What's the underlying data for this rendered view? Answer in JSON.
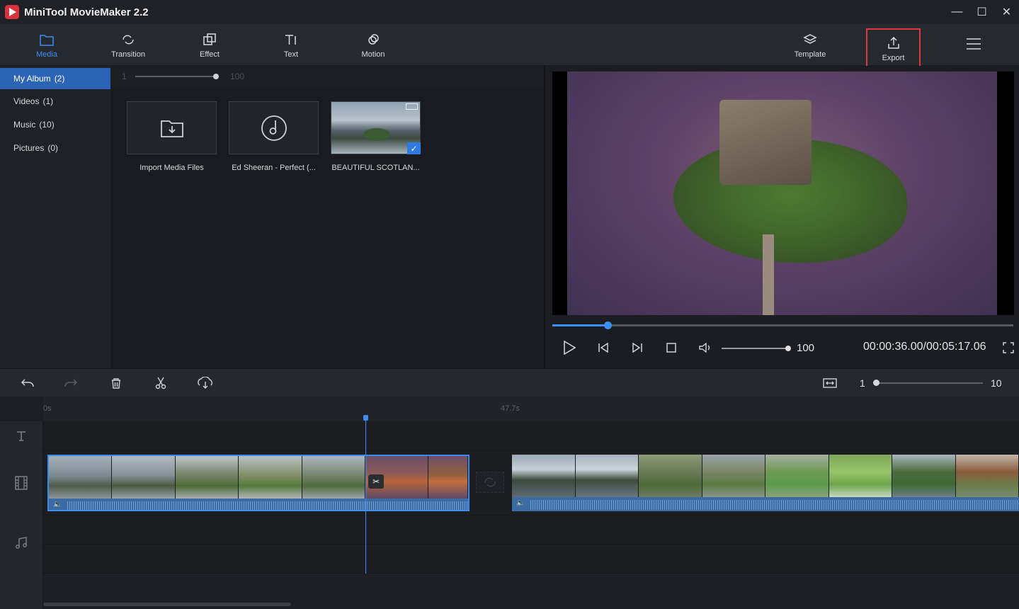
{
  "app": {
    "title": "MiniTool MovieMaker 2.2"
  },
  "window_controls": {
    "minimize": "—",
    "maximize": "☐",
    "close": "✕"
  },
  "toolbar": {
    "media": "Media",
    "transition": "Transition",
    "effect": "Effect",
    "text": "Text",
    "motion": "Motion",
    "template": "Template",
    "export": "Export"
  },
  "library": {
    "items": [
      {
        "label": "My Album",
        "count": "(2)"
      },
      {
        "label": "Videos",
        "count": "(1)"
      },
      {
        "label": "Music",
        "count": "(10)"
      },
      {
        "label": "Pictures",
        "count": "(0)"
      }
    ],
    "zoom_min": "1",
    "zoom_max": "100",
    "cards": [
      {
        "label": "Import Media Files"
      },
      {
        "label": "Ed Sheeran - Perfect (..."
      },
      {
        "label": "BEAUTIFUL SCOTLAN..."
      }
    ]
  },
  "player": {
    "progress_fraction": 0.12,
    "volume": "100",
    "time": "00:00:36.00/00:05:17.06"
  },
  "timeline": {
    "ruler": [
      "0s",
      "47.7s"
    ],
    "zoom_min": "1",
    "zoom_max": "10"
  },
  "colors": {
    "accent": "#3d8ef1",
    "export_highlight": "#e0363f",
    "selection": "#2b64b7"
  }
}
